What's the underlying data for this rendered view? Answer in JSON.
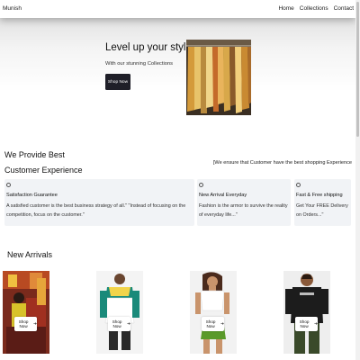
{
  "navbar": {
    "brand": "Munish",
    "links": [
      "Home",
      "Collections",
      "Contact"
    ]
  },
  "hero": {
    "title": "Level up your style",
    "subtitle": "With our stunning Collections",
    "button_label": "Shop Now"
  },
  "provide": {
    "heading_line1": "We Provide Best",
    "heading_line2": "Customer Experience",
    "tagline": "[We ensure that Customer have the best shopping Experience"
  },
  "features": [
    {
      "icon": "circle-icon",
      "title": "Satisfaction Guarantee",
      "text": "A satisfied customer is the best business strategy of all.\" \"Instead of focusing on the competition, focus on the customer.\""
    },
    {
      "icon": "circle-icon",
      "title": "New Arrival Everyday",
      "text": "Fashion is the armor to survive the reality of everyday life...\""
    },
    {
      "icon": "circle-icon",
      "title": "Fast & Free shipping",
      "text": "Get Your FREE Delivery on Orders...\""
    }
  ],
  "arrivals": {
    "title": "New Arrivals",
    "button_label": "Shop Now",
    "arrow": "➔"
  }
}
